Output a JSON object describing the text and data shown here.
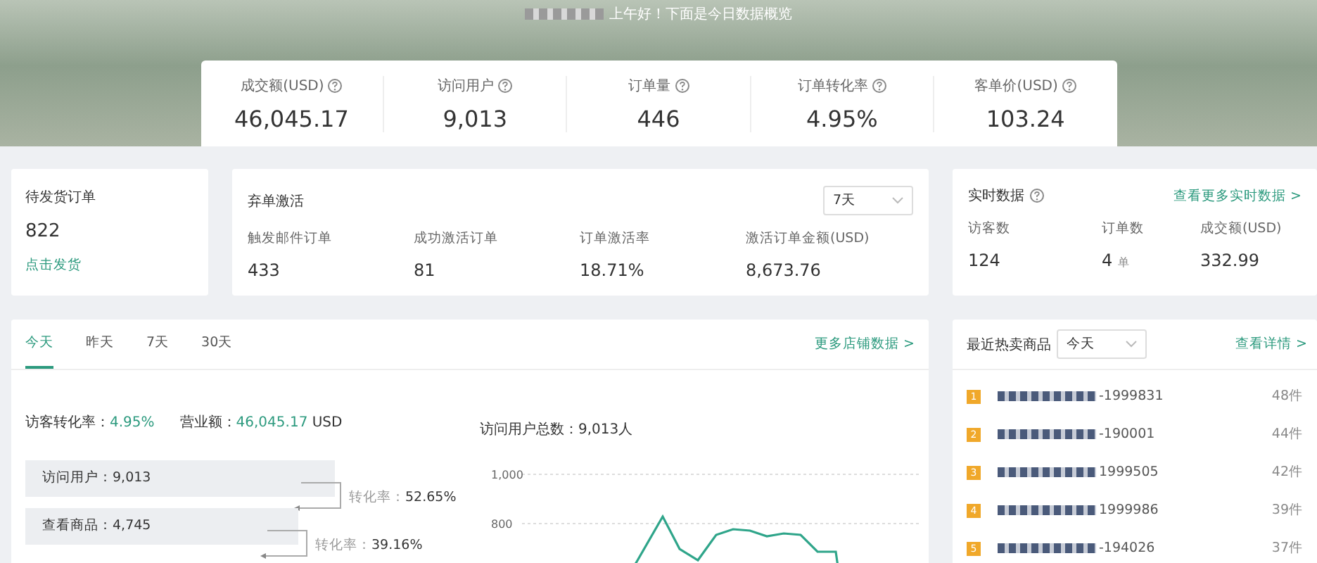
{
  "banner": {
    "greeting": "上午好！下面是今日数据概览"
  },
  "summary_stats": [
    {
      "label": "成交额(USD)",
      "value": "46,045.17"
    },
    {
      "label": "访问用户",
      "value": "9,013"
    },
    {
      "label": "订单量",
      "value": "446"
    },
    {
      "label": "订单转化率",
      "value": "4.95%"
    },
    {
      "label": "客单价(USD)",
      "value": "103.24"
    }
  ],
  "pending_orders": {
    "title": "待发货订单",
    "value": "822",
    "link": "点击发货"
  },
  "abandoned_cart": {
    "title": "弃单激活",
    "period": "7天",
    "metrics": [
      {
        "label": "触发邮件订单",
        "value": "433"
      },
      {
        "label": "成功激活订单",
        "value": "81"
      },
      {
        "label": "订单激活率",
        "value": "18.71%"
      },
      {
        "label": "激活订单金额(USD)",
        "value": "8,673.76"
      }
    ]
  },
  "realtime": {
    "title": "实时数据",
    "link": "查看更多实时数据 >",
    "metrics": [
      {
        "label": "访客数",
        "value": "124"
      },
      {
        "label": "订单数",
        "value": "4",
        "unit": "单"
      },
      {
        "label": "成交额(USD)",
        "value": "332.99"
      }
    ]
  },
  "overview": {
    "tabs": [
      {
        "label": "今天",
        "selected": true
      },
      {
        "label": "昨天",
        "selected": false
      },
      {
        "label": "7天",
        "selected": false
      },
      {
        "label": "30天",
        "selected": false
      }
    ],
    "link": "更多店铺数据 >",
    "conversion": {
      "label": "访客转化率：",
      "value": "4.95%"
    },
    "revenue": {
      "label": "营业额：",
      "value": "46,045.17",
      "unit": "USD"
    },
    "funnel": [
      {
        "label": "访问用户：9,013",
        "rate_label": "转化率：",
        "rate": "52.65%"
      },
      {
        "label": "查看商品：4,745",
        "rate_label": "转化率：",
        "rate": "39.16%"
      }
    ],
    "visitors_total": "访问用户总数：9,013人",
    "chart_axis_labels": [
      "1,000",
      "800"
    ]
  },
  "hot_products": {
    "title": "最近热卖商品",
    "period": "今天",
    "link": "查看详情 >",
    "items": [
      {
        "rank": "1",
        "name": "-1999831",
        "sales": "48件"
      },
      {
        "rank": "2",
        "name": "-190001",
        "sales": "44件"
      },
      {
        "rank": "3",
        "name": "1999505",
        "sales": "42件"
      },
      {
        "rank": "4",
        "name": "1999986",
        "sales": "39件"
      },
      {
        "rank": "5",
        "name": "-194026",
        "sales": "37件"
      }
    ]
  }
}
